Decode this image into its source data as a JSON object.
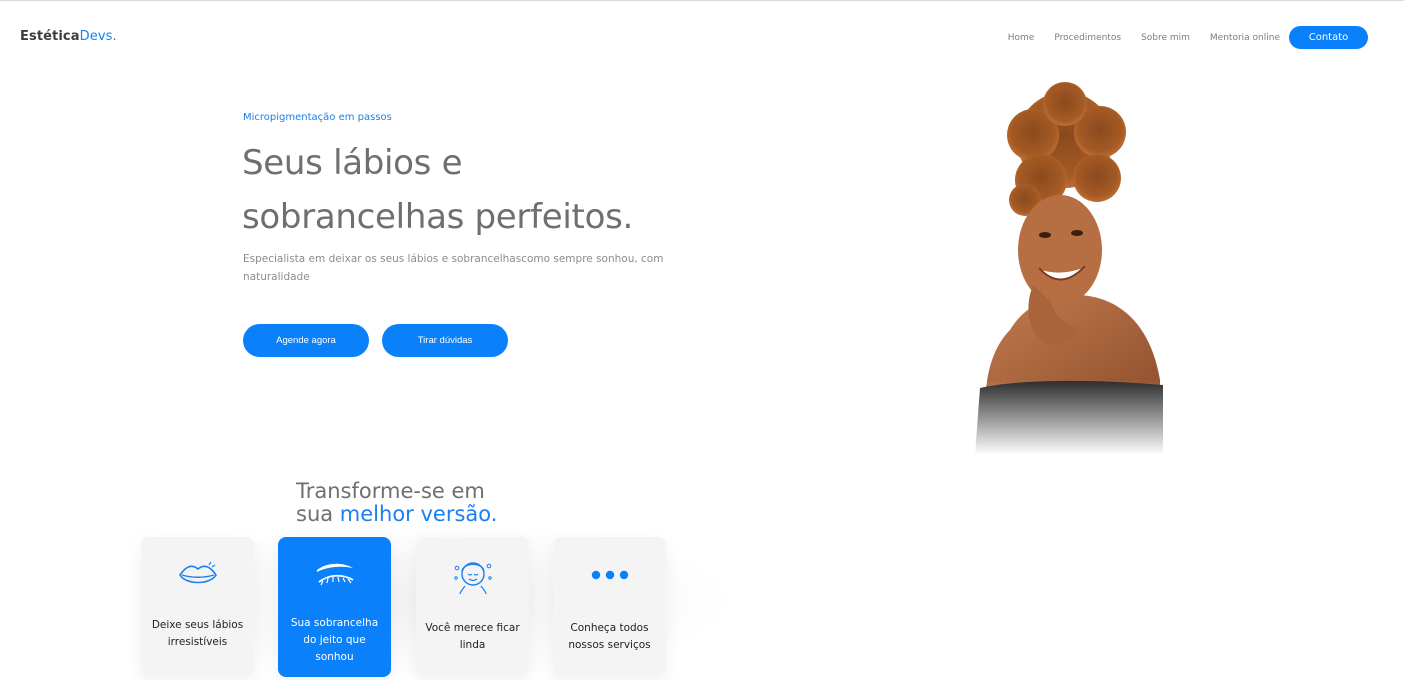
{
  "brand": {
    "part1": "Estética",
    "part2": "Devs",
    "dot": "."
  },
  "nav": {
    "items": [
      "Home",
      "Procedimentos",
      "Sobre mim",
      "Mentoria online"
    ],
    "contact": "Contato"
  },
  "hero": {
    "eyebrow": "Micropigmentação em passos",
    "title_line1": "Seus lábios e",
    "title_line2": "sobrancelhas perfeitos.",
    "lead": "Especialista em deixar os seus lábios e sobrancelhascomo sempre sonhou, com naturalidade",
    "cta_primary": "Agende agora",
    "cta_secondary": "Tirar dúvidas"
  },
  "section": {
    "title_line1": "Transforme-se em",
    "title_line2_plain": "sua ",
    "title_line2_accent": "melhor versão."
  },
  "cards": [
    {
      "icon": "lips-icon",
      "label": "Deixe seus lábios irresistíveis"
    },
    {
      "icon": "eyebrow-icon",
      "label": "Sua sobrancelha do jeito que sonhou"
    },
    {
      "icon": "face-care-icon",
      "label": "Você merece ficar linda"
    },
    {
      "icon": "more-dots-icon",
      "label": "Conheça todos nossos serviços"
    }
  ],
  "colors": {
    "accent": "#0a80fb",
    "text": "#6f6f6f",
    "card_bg": "#f4f4f4"
  }
}
